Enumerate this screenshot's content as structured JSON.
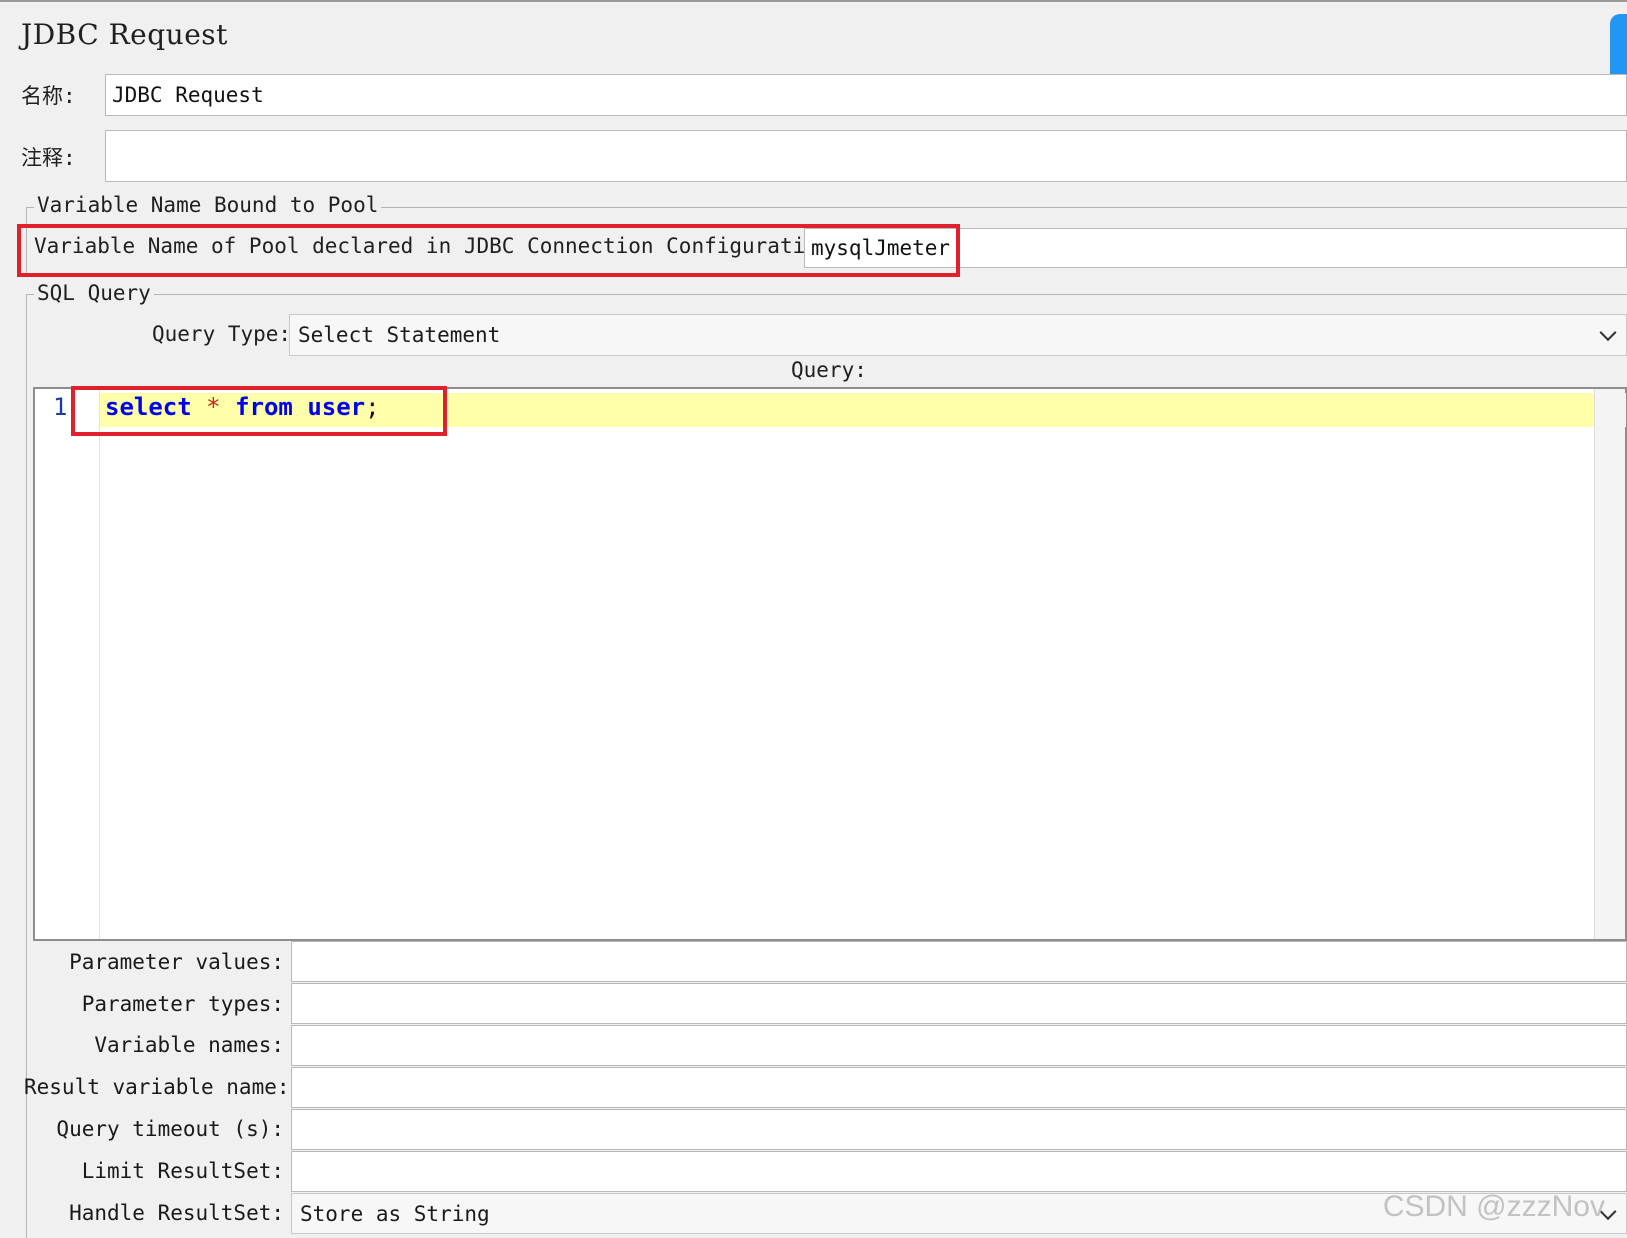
{
  "panel": {
    "title": "JDBC Request"
  },
  "name_row": {
    "label": "名称:",
    "value": "JDBC Request"
  },
  "comment_row": {
    "label": "注释:",
    "value": ""
  },
  "pool_group": {
    "title": "Variable Name Bound to Pool",
    "label": "Variable Name of Pool declared in JDBC Connection Configuration:",
    "value": "mysqlJmeter"
  },
  "sql_group": {
    "title": "SQL Query",
    "query_type_label": "Query Type:",
    "query_type_value": "Select Statement",
    "query_label": "Query:"
  },
  "editor": {
    "line_number": "1",
    "tokens": {
      "select": "select",
      "star": "*",
      "from": "from",
      "table": "user",
      "semicolon": ";"
    }
  },
  "params": [
    {
      "label": "Parameter values:",
      "value": ""
    },
    {
      "label": "Parameter types:",
      "value": ""
    },
    {
      "label": "Variable names:",
      "value": ""
    },
    {
      "label": "Result variable name:",
      "value": ""
    },
    {
      "label": "Query timeout (s):",
      "value": ""
    },
    {
      "label": "Limit ResultSet:",
      "value": ""
    },
    {
      "label": "Handle ResultSet:",
      "value": "Store as String"
    }
  ],
  "watermark": "CSDN @zzzNov",
  "colors": {
    "highlight_border": "#e0212b",
    "keyword": "#0000ee",
    "current_line": "#ffffaa",
    "accent_tab": "#2196f3"
  }
}
